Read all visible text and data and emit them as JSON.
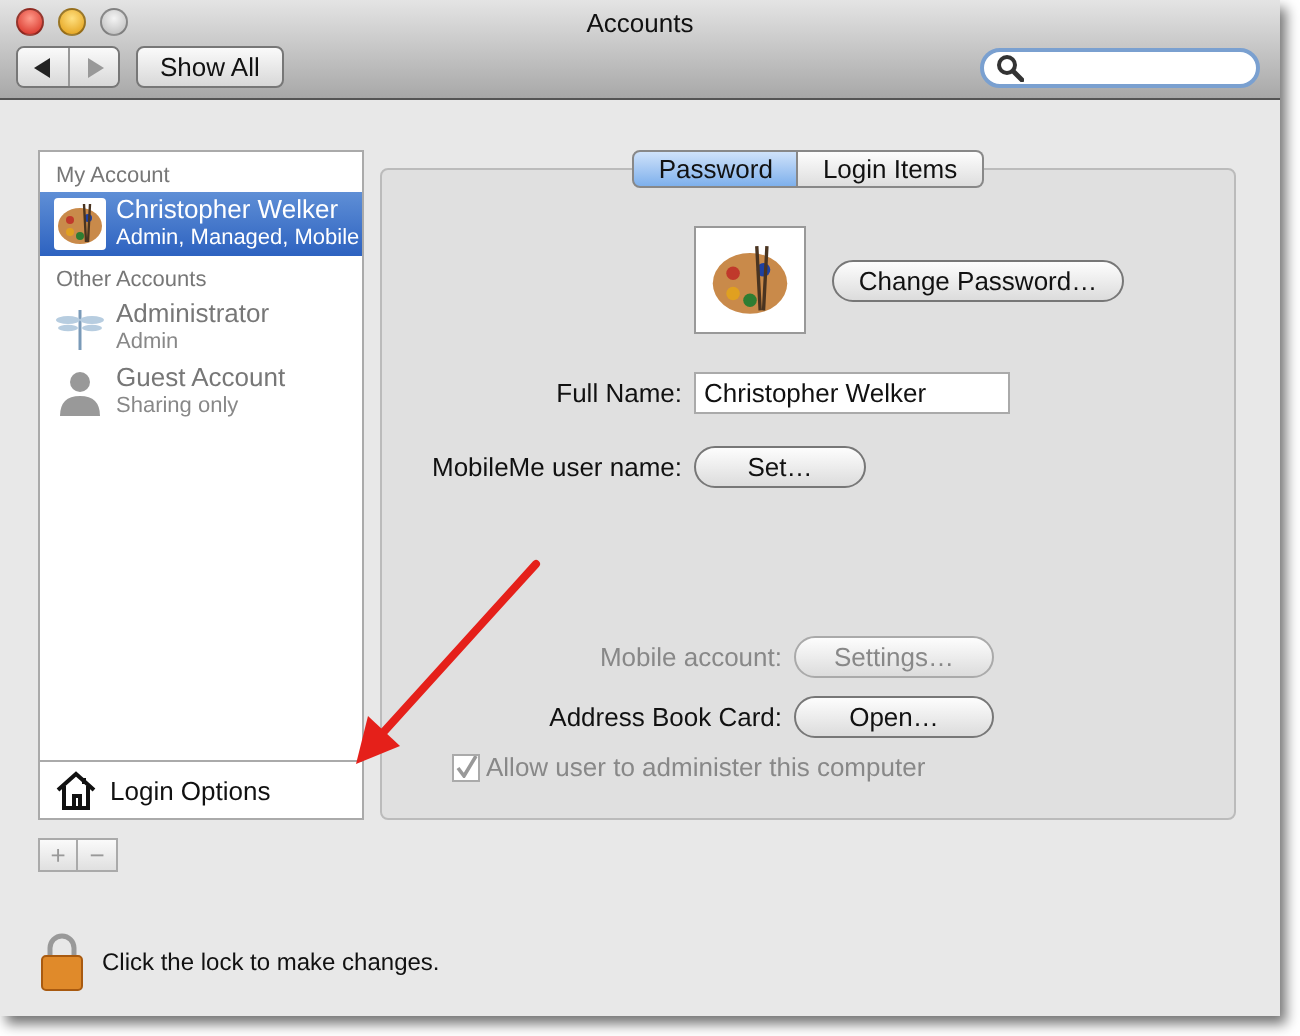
{
  "window": {
    "title": "Accounts"
  },
  "toolbar": {
    "show_all": "Show All"
  },
  "sidebar": {
    "sections": [
      {
        "heading": "My Account",
        "items": [
          {
            "name": "Christopher Welker",
            "detail": "Admin, Managed, Mobile",
            "selected": true,
            "kind": "palette"
          }
        ]
      },
      {
        "heading": "Other Accounts",
        "items": [
          {
            "name": "Administrator",
            "detail": "Admin",
            "selected": false,
            "kind": "dragonfly"
          },
          {
            "name": "Guest Account",
            "detail": "Sharing only",
            "selected": false,
            "kind": "person"
          }
        ]
      }
    ],
    "login_options": "Login Options",
    "add": "+",
    "remove": "−"
  },
  "tabs": [
    {
      "label": "Password",
      "selected": true
    },
    {
      "label": "Login Items",
      "selected": false
    }
  ],
  "password_pane": {
    "change_password": "Change Password…",
    "full_name": {
      "label": "Full Name:",
      "value": "Christopher Welker"
    },
    "mobileme": {
      "label": "MobileMe user name:",
      "button": "Set…"
    },
    "mobile_account": {
      "label": "Mobile account:",
      "button": "Settings…",
      "disabled": true
    },
    "address_book": {
      "label": "Address Book Card:",
      "button": "Open…",
      "disabled": false
    },
    "allow_admin": {
      "label": "Allow user to administer this computer",
      "checked": true,
      "disabled": true
    }
  },
  "lock_text": "Click the lock to make changes."
}
